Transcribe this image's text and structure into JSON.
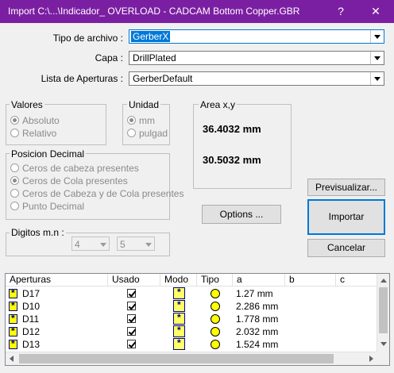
{
  "window": {
    "title": "Import   C:\\...\\Indicador_ OVERLOAD - CADCAM Bottom Copper.GBR",
    "help": "?",
    "close": "✕"
  },
  "form": {
    "tipo_label": "Tipo de archivo :",
    "tipo_value": "GerberX",
    "capa_label": "Capa :",
    "capa_value": "DrillPlated",
    "lista_label": "Lista de Aperturas :",
    "lista_value": "GerberDefault"
  },
  "valores": {
    "title": "Valores",
    "absoluto": "Absoluto",
    "relativo": "Relativo",
    "selected": "Absoluto"
  },
  "unidad": {
    "title": "Unidad",
    "mm": "mm",
    "pulgad": "pulgad",
    "selected": "mm"
  },
  "area": {
    "title": "Area x,y",
    "x": "36.4032 mm",
    "y": "30.5032 mm"
  },
  "posicion": {
    "title": "Posicion Decimal",
    "opt1": "Ceros de cabeza presentes",
    "opt2": "Ceros de Cola presentes",
    "opt3": "Ceros de Cabeza y de Cola presentes",
    "opt4": "Punto Decimal",
    "selected": "Ceros de Cola presentes"
  },
  "digitos": {
    "title": "Digitos  m.n :",
    "m": "4",
    "n": "5"
  },
  "buttons": {
    "previsualizar": "Previsualizar...",
    "options": "Options ...",
    "importar": "Importar",
    "cancelar": "Cancelar"
  },
  "table": {
    "headers": [
      "Aperturas",
      "Usado",
      "Modo",
      "Tipo",
      "a",
      "b",
      "c"
    ],
    "rows": [
      {
        "name": "D17",
        "used": true,
        "a": "1.27 mm"
      },
      {
        "name": "D10",
        "used": true,
        "a": "2.286 mm"
      },
      {
        "name": "D11",
        "used": true,
        "a": "1.778 mm"
      },
      {
        "name": "D12",
        "used": true,
        "a": "2.032 mm"
      },
      {
        "name": "D13",
        "used": true,
        "a": "1.524 mm"
      }
    ]
  },
  "colors": {
    "titlebar": "#7b1fa2",
    "selection": "#0078d7"
  }
}
